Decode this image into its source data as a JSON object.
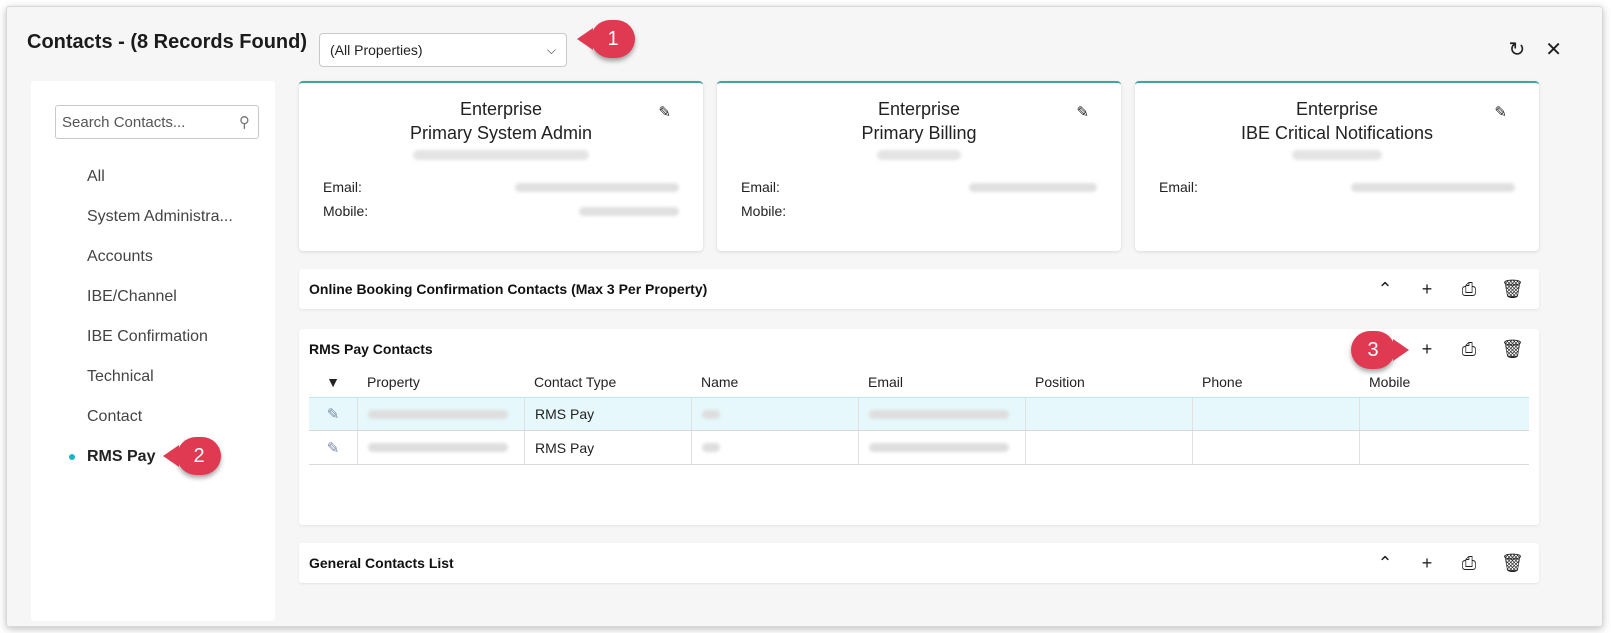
{
  "header": {
    "title": "Contacts - (8 Records Found)",
    "property_select": "(All Properties)",
    "callout_1": "1",
    "callout_2": "2",
    "callout_3": "3"
  },
  "sidebar": {
    "search_placeholder": "Search Contacts...",
    "items": [
      {
        "label": "All"
      },
      {
        "label": "System Administra..."
      },
      {
        "label": "Accounts"
      },
      {
        "label": "IBE/Channel"
      },
      {
        "label": "IBE Confirmation"
      },
      {
        "label": "Technical"
      },
      {
        "label": "Contact"
      },
      {
        "label": "RMS Pay"
      }
    ]
  },
  "cards": [
    {
      "line1": "Enterprise",
      "line2": "Primary System Admin",
      "email_label": "Email:",
      "mobile_label": "Mobile:"
    },
    {
      "line1": "Enterprise",
      "line2": "Primary Billing",
      "email_label": "Email:",
      "mobile_label": "Mobile:"
    },
    {
      "line1": "Enterprise",
      "line2": "IBE Critical Notifications",
      "email_label": "Email:"
    }
  ],
  "panels": {
    "online_booking": {
      "title": "Online Booking Confirmation Contacts (Max 3 Per Property)"
    },
    "rms_pay": {
      "title": "RMS Pay Contacts",
      "columns": [
        "Property",
        "Contact Type",
        "Name",
        "Email",
        "Position",
        "Phone",
        "Mobile"
      ],
      "rows": [
        {
          "contact_type": "RMS Pay"
        },
        {
          "contact_type": "RMS Pay"
        }
      ]
    },
    "general": {
      "title": "General Contacts List"
    }
  },
  "icons": {
    "refresh": "refresh-icon",
    "close": "close-icon",
    "edit": "pencil-icon",
    "collapse": "chevron-up-icon",
    "add": "plus-icon",
    "print": "printer-icon",
    "delete": "trash-icon",
    "sort": "caret-down-icon"
  },
  "colors": {
    "accent_teal": "#3aa89a",
    "active_dot": "#1bb5c6",
    "callout": "#e03a52",
    "selected_row": "#e6f8fb"
  }
}
